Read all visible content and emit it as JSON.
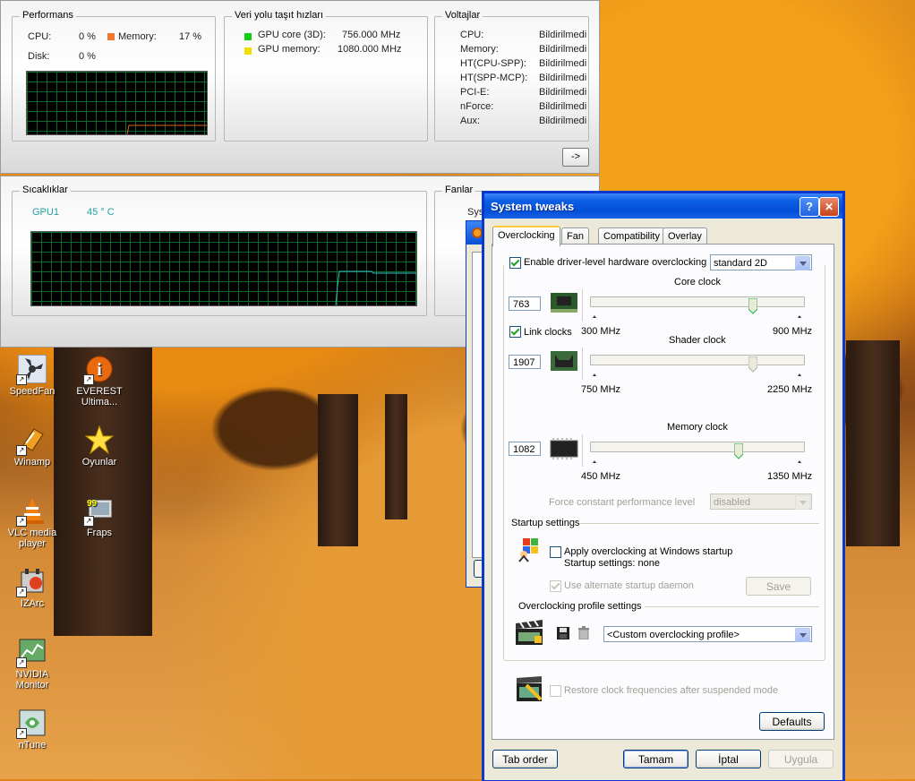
{
  "desktop_icons": [
    {
      "label": "SpeedFan",
      "icon": "speedfan-icon"
    },
    {
      "label": "EVEREST Ultima...",
      "icon": "everest-icon"
    },
    {
      "label": "Winamp",
      "icon": "winamp-icon"
    },
    {
      "label": "Oyunlar",
      "icon": "star-icon"
    },
    {
      "label": "VLC media player",
      "icon": "vlc-icon"
    },
    {
      "label": "Fraps",
      "icon": "fraps-icon"
    },
    {
      "label": "IZArc",
      "icon": "izarc-icon"
    },
    {
      "label": "NVIDIA Monitor",
      "icon": "nvidia-monitor-icon"
    },
    {
      "label": "nTune",
      "icon": "ntune-icon"
    }
  ],
  "monitor": {
    "performance": {
      "title": "Performans",
      "cpu_label": "CPU:",
      "cpu_value": "0 %",
      "memory_label": "Memory:",
      "memory_value": "17 %",
      "disk_label": "Disk:",
      "disk_value": "0 %"
    },
    "bus": {
      "title": "Veri yolu taşıt hızları",
      "gpu_core_label": "GPU core (3D):",
      "gpu_core_value": "756.000 MHz",
      "gpu_mem_label": "GPU memory:",
      "gpu_mem_value": "1080.000 MHz",
      "core_color": "#00c000",
      "mem_color": "#f0e000"
    },
    "voltages": {
      "title": "Voltajlar",
      "rows": [
        {
          "label": "CPU:",
          "value": "Bildirilmedi"
        },
        {
          "label": "Memory:",
          "value": "Bildirilmedi"
        },
        {
          "label": "HT(CPU-SPP):",
          "value": "Bildirilmedi"
        },
        {
          "label": "HT(SPP-MCP):",
          "value": "Bildirilmedi"
        },
        {
          "label": "PCI-E:",
          "value": "Bildirilmedi"
        },
        {
          "label": "nForce:",
          "value": "Bildirilmedi"
        },
        {
          "label": "Aux:",
          "value": "Bildirilmedi"
        }
      ]
    },
    "more_button": "->",
    "temps": {
      "title": "Sıcaklıklar",
      "gpu_label": "GPU1",
      "gpu_value": "45 ° C",
      "color": "#20a0a0"
    },
    "fans": {
      "title": "Fanlar",
      "partial_text": "Syst"
    }
  },
  "dialog": {
    "title": "System tweaks",
    "help_btn": "?",
    "close_btn": "✕",
    "tabs": [
      "Overclocking",
      "Fan",
      "Compatibility",
      "Overlay"
    ],
    "active_tab": 0,
    "enable_hw_oc": {
      "label": "Enable driver-level hardware overclocking",
      "checked": true
    },
    "mode_combo": "standard 2D",
    "core_clock": {
      "title": "Core clock",
      "value": "763",
      "min": "300 MHz",
      "max": "900 MHz",
      "fraction": 0.77
    },
    "link_clocks": {
      "label": "Link clocks",
      "checked": true
    },
    "shader_clock": {
      "title": "Shader clock",
      "value": "1907",
      "min": "750 MHz",
      "max": "2250 MHz",
      "fraction": 0.77
    },
    "memory_clock": {
      "title": "Memory clock",
      "value": "1082",
      "min": "450 MHz",
      "max": "1350 MHz",
      "fraction": 0.7
    },
    "force_perf_label": "Force constant performance level",
    "force_perf_combo": "disabled",
    "startup": {
      "title": "Startup settings",
      "apply_label": "Apply overclocking at Windows startup",
      "apply_checked": false,
      "settings_text": "Startup settings: none",
      "daemon_label": "Use alternate startup daemon",
      "daemon_checked": true,
      "save_btn": "Save"
    },
    "profile": {
      "title": "Overclocking profile settings",
      "combo": "<Custom overclocking profile>"
    },
    "restore_label": "Restore clock frequencies after suspended mode",
    "defaults_btn": "Defaults",
    "footer": {
      "tab_order": "Tab order",
      "ok": "Tamam",
      "cancel": "İptal",
      "apply": "Uygula"
    }
  }
}
